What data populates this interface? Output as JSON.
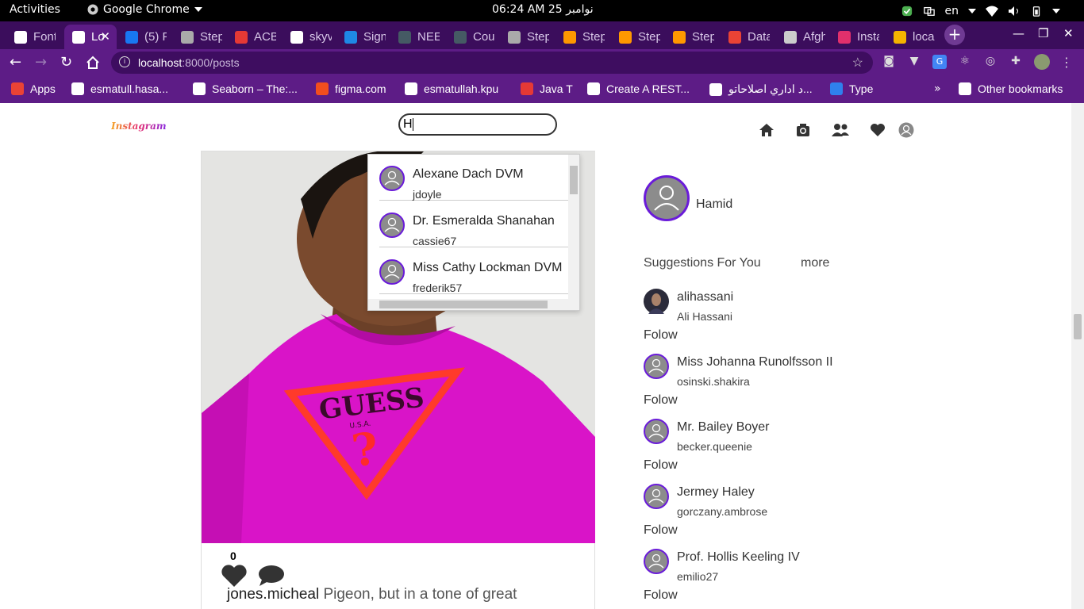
{
  "system": {
    "activities": "Activities",
    "app_name": "Google Chrome",
    "clock": "06:24 AM  25 نوامبر",
    "lang": "en"
  },
  "tabs": [
    {
      "label": "Font",
      "color": "#ffffff"
    },
    {
      "label": "Lo",
      "color": "#ffffff",
      "active": true
    },
    {
      "label": "(5) F",
      "color": "#1877f2"
    },
    {
      "label": "Step",
      "color": "#aaaaaa"
    },
    {
      "label": "ACB",
      "color": "#e53935"
    },
    {
      "label": "skyv",
      "color": "#ffffff"
    },
    {
      "label": "Sign",
      "color": "#1e88e5"
    },
    {
      "label": "NEE",
      "color": "#455a64"
    },
    {
      "label": "Cou",
      "color": "#455a64"
    },
    {
      "label": "Step",
      "color": "#aaaaaa"
    },
    {
      "label": "Step",
      "color": "#ff9800"
    },
    {
      "label": "Step",
      "color": "#ff9800"
    },
    {
      "label": "Step",
      "color": "#ff9800"
    },
    {
      "label": "Data",
      "color": "#ea4335"
    },
    {
      "label": "Afgh",
      "color": "#cccccc"
    },
    {
      "label": "Insta",
      "color": "#e1306c"
    },
    {
      "label": "loca",
      "color": "#f5b400"
    }
  ],
  "toolbar": {
    "url_host": "localhost",
    "url_path": ":8000/posts"
  },
  "bookmarks": [
    {
      "label": "Apps",
      "color": "#ea4335"
    },
    {
      "label": "esmatull.hasa...",
      "color": "#ffffff"
    },
    {
      "label": "Seaborn – The:...",
      "color": "#ffffff"
    },
    {
      "label": "figma.com",
      "color": "#f24e1e"
    },
    {
      "label": "esmatullah.kpu",
      "color": "#ffffff"
    },
    {
      "label": "Java T",
      "color": "#e53935"
    },
    {
      "label": "Create A REST...",
      "color": "#ffffff"
    },
    {
      "label": "د اداري اصلاحاتو...",
      "color": "#ffffff"
    },
    {
      "label": "Type",
      "color": "#2f80ed"
    },
    {
      "label": "Other bookmarks",
      "color": "#ffffff"
    }
  ],
  "page": {
    "logo": "Instagram",
    "search_value": "H",
    "search_results": [
      {
        "name": "Alexane Dach DVM",
        "username": "jdoyle"
      },
      {
        "name": "Dr. Esmeralda Shanahan",
        "username": "cassie67"
      },
      {
        "name": "Miss Cathy Lockman DVM",
        "username": "frederik57"
      }
    ],
    "post": {
      "likes": "0",
      "username": "jones.micheal",
      "caption": "Pigeon, but in a tone of great",
      "shirt_text": "GUESS",
      "shirt_sub": "U.S.A."
    },
    "profile": {
      "name": "Hamid"
    },
    "suggestions_title": "Suggestions For You",
    "suggestions_more": "more",
    "suggestions": [
      {
        "name": "alihassani",
        "username": "Ali Hassani",
        "follow": "Folow"
      },
      {
        "name": "Miss Johanna Runolfsson II",
        "username": "osinski.shakira",
        "follow": "Folow"
      },
      {
        "name": "Mr. Bailey Boyer",
        "username": "becker.queenie",
        "follow": "Folow"
      },
      {
        "name": "Jermey Haley",
        "username": "gorczany.ambrose",
        "follow": "Folow"
      },
      {
        "name": "Prof. Hollis Keeling IV",
        "username": "emilio27",
        "follow": "Folow"
      }
    ]
  },
  "colors": {
    "chrome_dark": "#3b0d5c",
    "chrome_toolbar": "#5d1c86",
    "avatar_ring": "#6a1bd9",
    "avatar_fill": "#8c8c8c",
    "shirt": "#d914c8"
  }
}
